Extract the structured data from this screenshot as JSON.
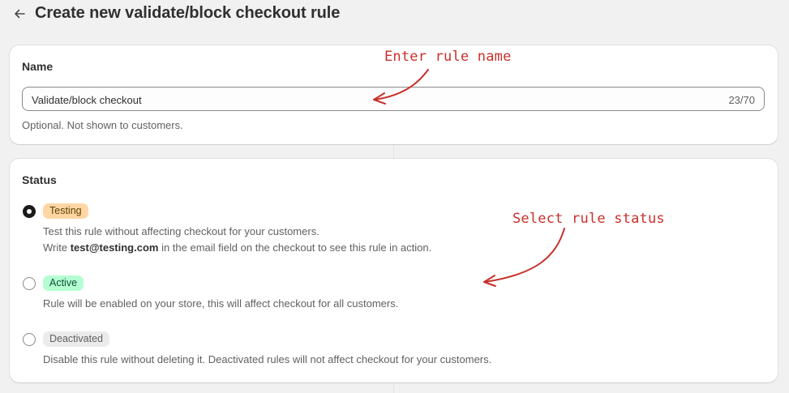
{
  "header": {
    "back_icon": "arrow-left-icon",
    "title": "Create new validate/block checkout rule"
  },
  "name_section": {
    "title": "Name",
    "input_value": "Validate/block checkout",
    "char_count": "23/70",
    "help_text": "Optional. Not shown to customers."
  },
  "status_section": {
    "title": "Status",
    "selected": "Testing",
    "options": [
      {
        "badge": "Testing",
        "line1": "Test this rule without affecting checkout for your customers.",
        "line2_prefix": "Write ",
        "line2_bold": "test@testing.com",
        "line2_suffix": " in the email field on the checkout to see this rule in action."
      },
      {
        "badge": "Active",
        "line1": "Rule will be enabled on your store, this will affect checkout for all customers."
      },
      {
        "badge": "Deactivated",
        "line1": "Disable this rule without deleting it. Deactivated rules will not affect checkout for your customers."
      }
    ]
  },
  "annotations": {
    "rule_name": "Enter rule name",
    "rule_status": "Select rule status"
  },
  "colors": {
    "annotation": "#c8302a",
    "testing_badge_bg": "#ffd6a4",
    "active_badge_bg": "#b4fed2",
    "deactivated_badge_bg": "#ebebeb",
    "page_bg": "#f1f1f1"
  }
}
